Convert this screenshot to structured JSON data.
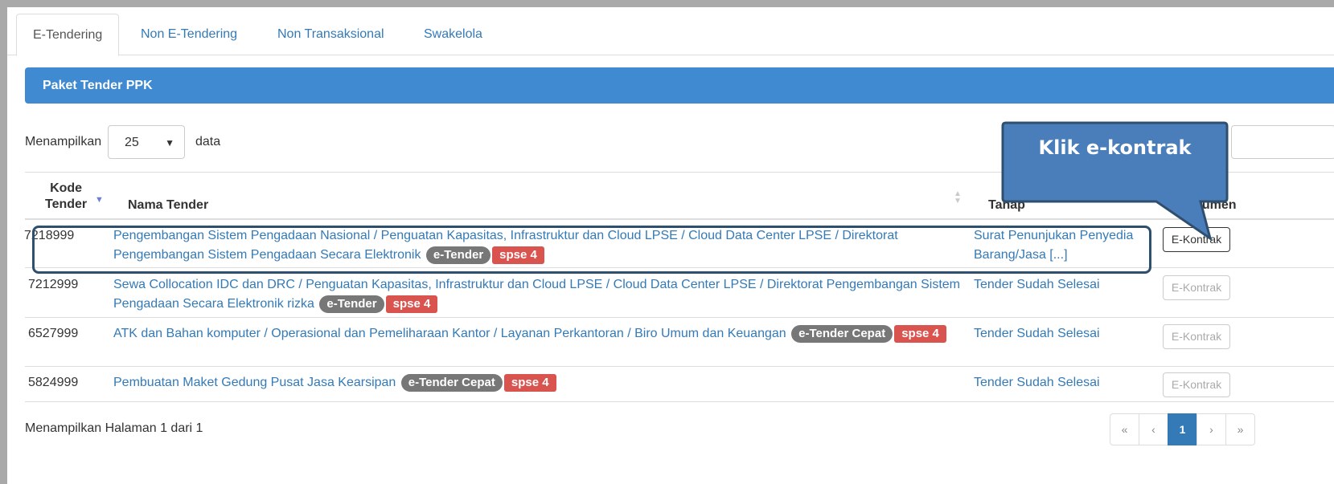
{
  "tabs": [
    {
      "label": "E-Tendering"
    },
    {
      "label": "Non E-Tendering"
    },
    {
      "label": "Non Transaksional"
    },
    {
      "label": "Swakelola"
    }
  ],
  "panel": {
    "title": "Paket Tender PPK"
  },
  "length_control": {
    "prefix": "Menampilkan",
    "value": "25",
    "arrow": "▼",
    "suffix": "data"
  },
  "table": {
    "headers": {
      "kode_line1": "Kode",
      "kode_line2": "Tender",
      "nama": "Nama Tender",
      "tahap": "Tahap",
      "dokumen": "kumen"
    },
    "rows": [
      {
        "kode": "7218999",
        "nama": "Pengembangan Sistem Pengadaan Nasional / Penguatan Kapasitas, Infrastruktur dan Cloud LPSE / Cloud Data Center LPSE / Direktorat Pengembangan Sistem Pengadaan Secara Elektronik",
        "badge1": "e-Tender",
        "badge2": "spse 4",
        "tahap": "Surat Penunjukan Penyedia Barang/Jasa [...]",
        "button": "E-Kontrak"
      },
      {
        "kode": "7212999",
        "nama": "Sewa Collocation IDC dan DRC / Penguatan Kapasitas, Infrastruktur dan Cloud LPSE / Cloud Data Center LPSE / Direktorat Pengembangan Sistem Pengadaan Secara Elektronik rizka",
        "badge1": "e-Tender",
        "badge2": "spse 4",
        "tahap": "Tender Sudah Selesai",
        "button": "E-Kontrak"
      },
      {
        "kode": "6527999",
        "nama": "ATK dan Bahan komputer / Operasional dan Pemeliharaan Kantor / Layanan Perkantoran / Biro Umum dan Keuangan",
        "badge1": "e-Tender Cepat",
        "badge2": "spse 4",
        "tahap": "Tender Sudah Selesai",
        "button": "E-Kontrak"
      },
      {
        "kode": "5824999",
        "nama": "Pembuatan Maket Gedung Pusat Jasa Kearsipan",
        "badge1": "e-Tender Cepat",
        "badge2": "spse 4",
        "tahap": "Tender Sudah Selesai",
        "button": "E-Kontrak"
      }
    ]
  },
  "footer": {
    "info": "Menampilkan Halaman 1 dari 1"
  },
  "pagination": {
    "first": "«",
    "prev": "‹",
    "current": "1",
    "next": "›",
    "last": "»"
  },
  "callout": {
    "text": "Klik e-kontrak"
  },
  "colors": {
    "panel": "#3f8ad0",
    "link": "#337ab7",
    "badge_grey": "#777777",
    "badge_red": "#d9534f",
    "callout_fill": "#4a7ebb",
    "callout_border": "#2f4f6f"
  }
}
